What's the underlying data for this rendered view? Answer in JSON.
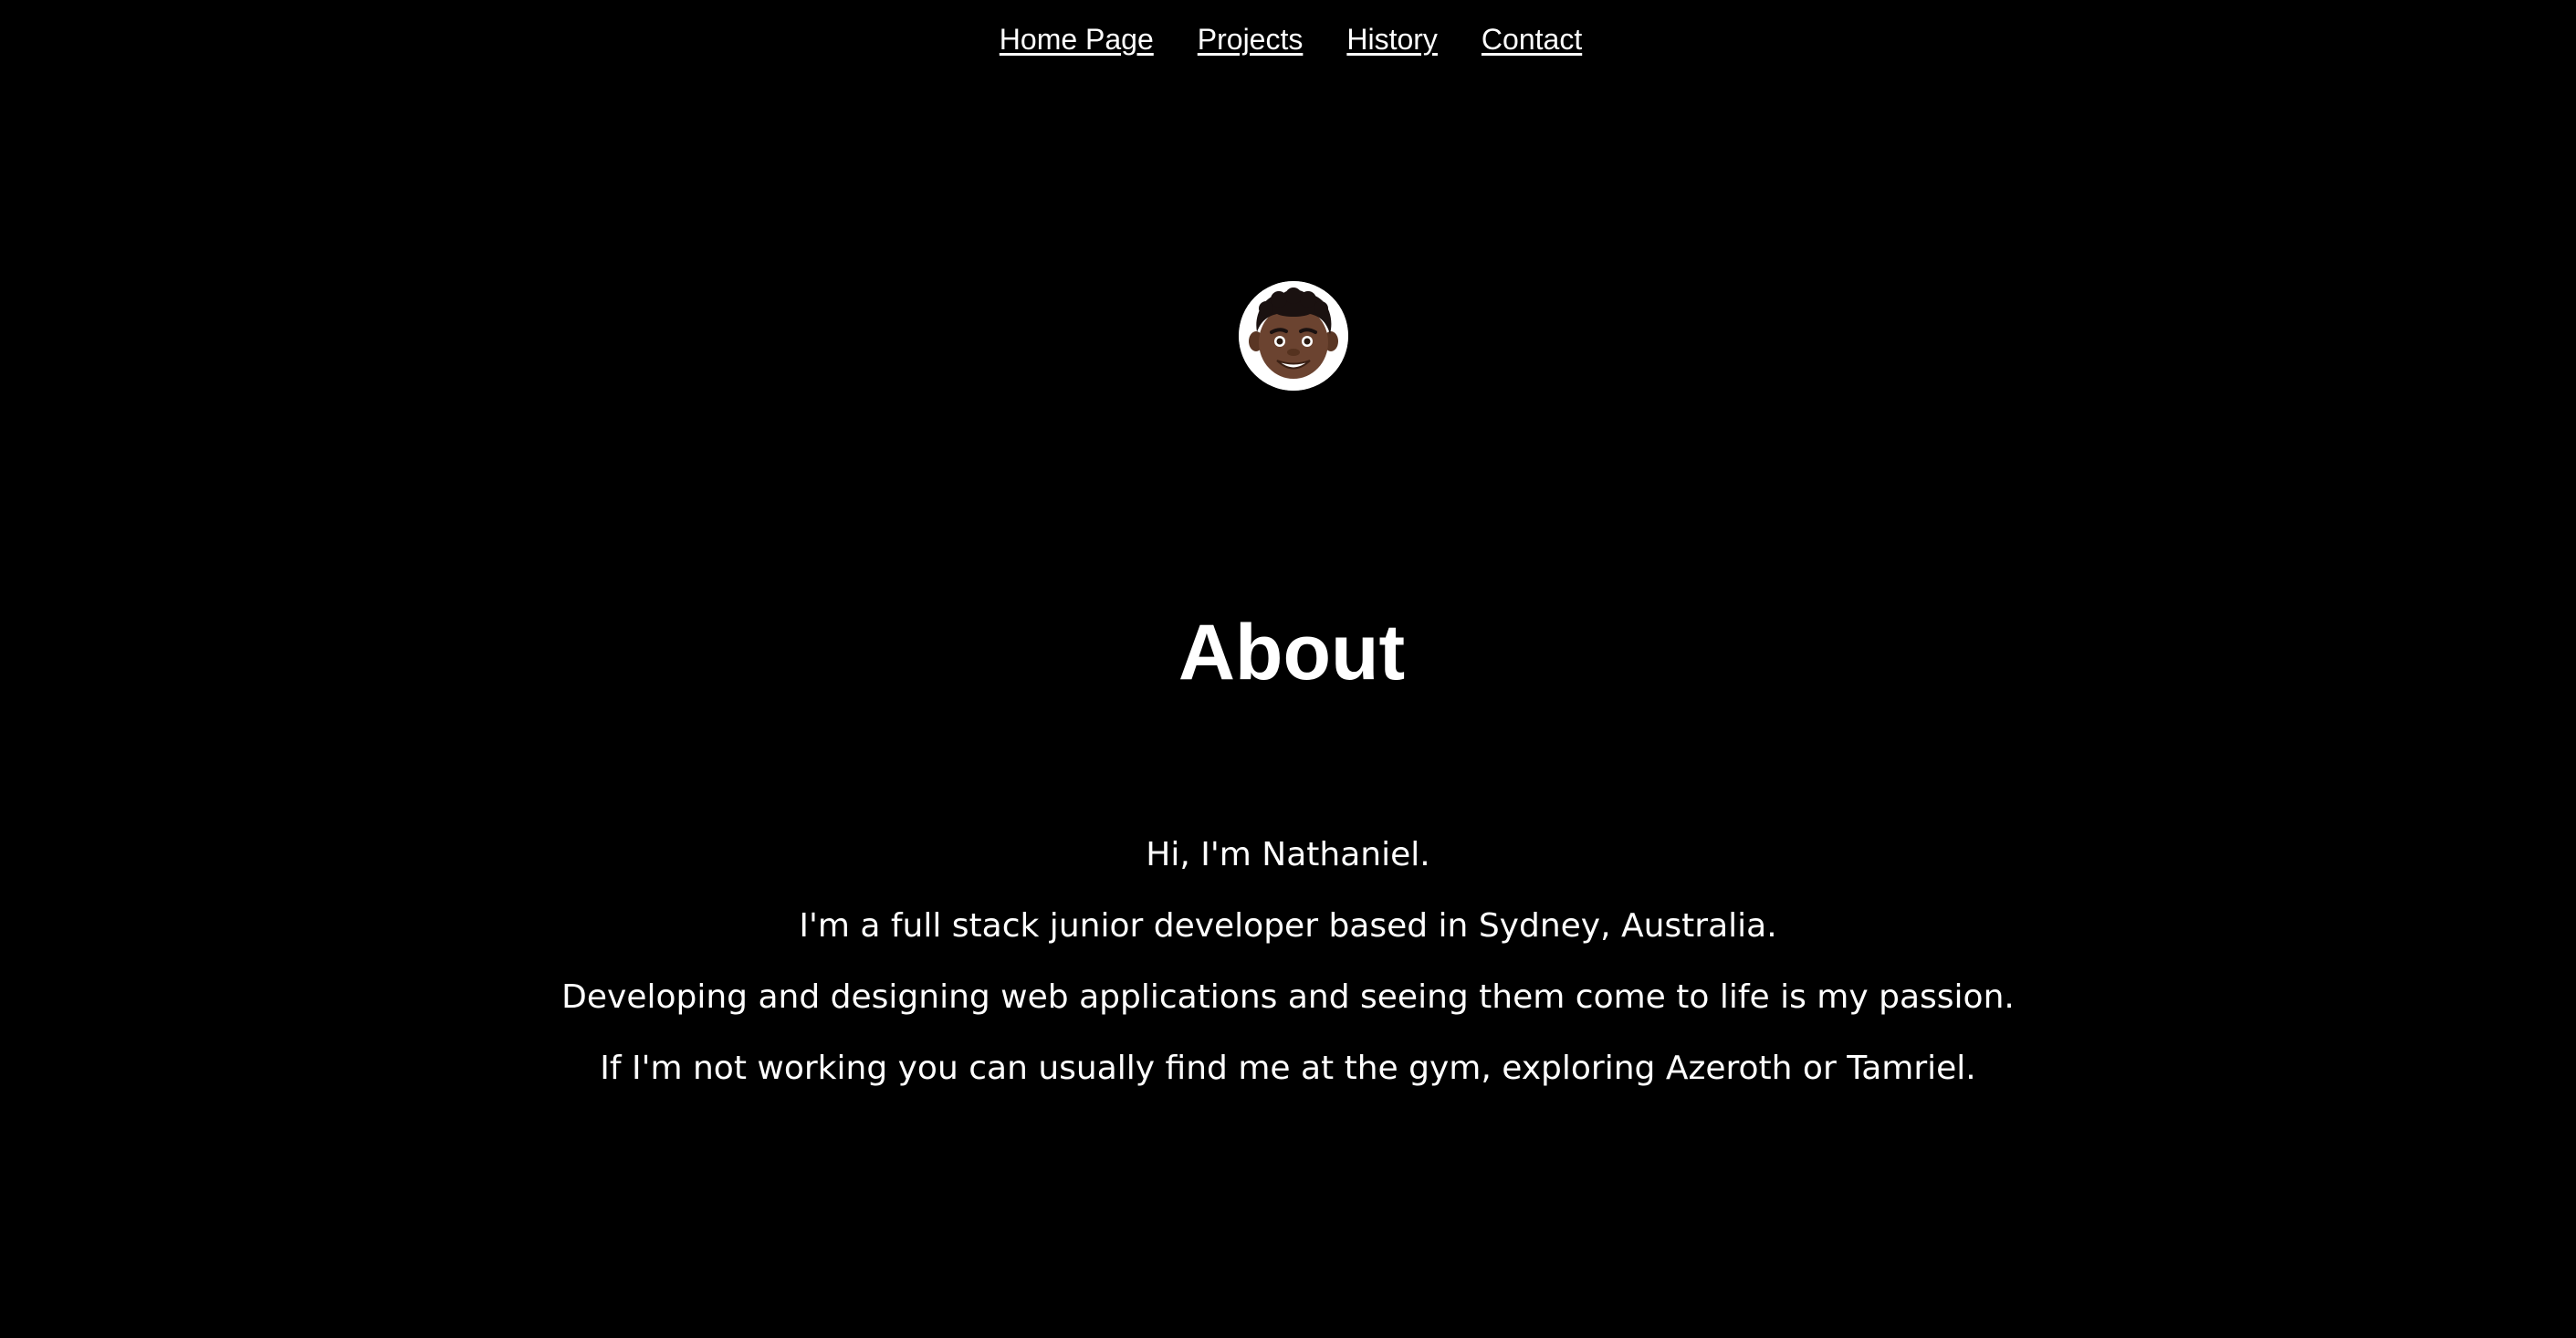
{
  "nav": {
    "items": [
      {
        "label": "Home Page"
      },
      {
        "label": "Projects"
      },
      {
        "label": "History"
      },
      {
        "label": "Contact"
      }
    ]
  },
  "about": {
    "title": "About",
    "paragraphs": [
      "Hi, I'm Nathaniel.",
      "I'm a full stack junior developer based in Sydney, Australia.",
      "Developing and designing web applications and seeing them come to life is my passion.",
      "If I'm not working you can usually find me at the gym, exploring Azeroth or Tamriel."
    ]
  },
  "colors": {
    "background": "#000000",
    "text": "#ffffff"
  }
}
